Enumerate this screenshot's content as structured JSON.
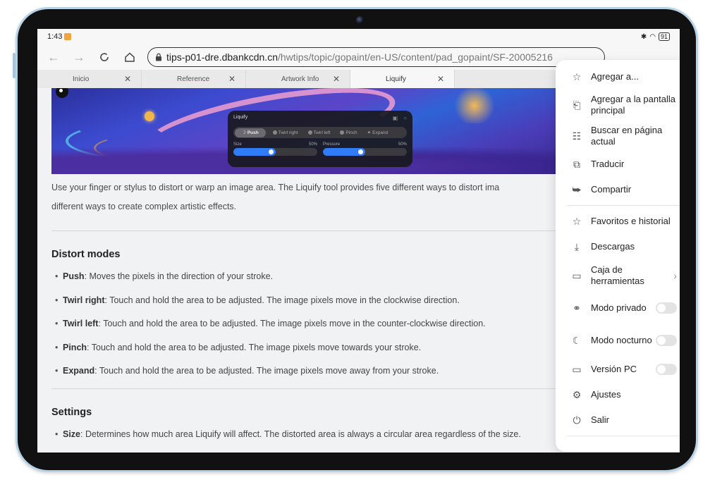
{
  "statusbar": {
    "time": "1:43",
    "battery": "91"
  },
  "toolbar": {
    "url_host": "tips-p01-dre.dbankcdn.cn",
    "url_path": "/hwtips/topic/gopaint/en-US/content/pad_gopaint/SF-20005216"
  },
  "tabs": [
    {
      "label": "Inicio",
      "active": false
    },
    {
      "label": "Reference",
      "active": false
    },
    {
      "label": "Artwork Info",
      "active": false
    },
    {
      "label": "Liquify",
      "active": true
    }
  ],
  "liquify_panel": {
    "title": "Liquify",
    "modes": [
      "Push",
      "Twirl right",
      "Twirl left",
      "Pinch",
      "Expand"
    ],
    "active_mode": "Push",
    "size_label": "Size",
    "size_value": "50%",
    "size_fraction": 0.5,
    "pressure_label": "Pressure",
    "pressure_value": "50%",
    "pressure_fraction": 0.5
  },
  "article": {
    "intro_line1": "Use your finger or stylus to distort or warp an image area. The Liquify tool provides five different ways to distort ima",
    "intro_line2": "different ways to create complex artistic effects.",
    "section1_title": "Distort modes",
    "modes": [
      {
        "term": "Push",
        "desc": ": Moves the pixels in the direction of your stroke."
      },
      {
        "term": "Twirl right",
        "desc": ": Touch and hold the area to be adjusted. The image pixels move in the clockwise direction."
      },
      {
        "term": "Twirl left",
        "desc": ": Touch and hold the area to be adjusted. The image pixels move in the counter-clockwise direction."
      },
      {
        "term": "Pinch",
        "desc": ": Touch and hold the area to be adjusted. The image pixels move towards your stroke."
      },
      {
        "term": "Expand",
        "desc": ": Touch and hold the area to be adjusted. The image pixels move away from your stroke."
      }
    ],
    "section2_title": "Settings",
    "settings": [
      {
        "term": "Size",
        "desc": ": Determines how much area Liquify will affect. The distorted area is always a circular area regardless of the size."
      }
    ]
  },
  "menu": {
    "items": [
      {
        "label": "Agregar a...",
        "icon": "star-icon"
      },
      {
        "label": "Agregar a la pantalla principal",
        "icon": "add-to-home-icon"
      },
      {
        "label": "Buscar en página actual",
        "icon": "find-in-page-icon"
      },
      {
        "label": "Traducir",
        "icon": "translate-icon"
      },
      {
        "label": "Compartir",
        "icon": "share-icon"
      },
      {
        "label": "Favoritos e historial",
        "icon": "bookmarks-history-icon"
      },
      {
        "label": "Descargas",
        "icon": "download-icon"
      },
      {
        "label": "Caja de herramientas",
        "icon": "toolbox-icon"
      },
      {
        "label": "Modo privado",
        "icon": "incognito-icon",
        "toggle": false
      },
      {
        "label": "Modo nocturno",
        "icon": "moon-icon",
        "toggle": false
      },
      {
        "label": "Versión PC",
        "icon": "desktop-icon",
        "toggle": false
      },
      {
        "label": "Ajustes",
        "icon": "settings-icon"
      },
      {
        "label": "Salir",
        "icon": "power-icon"
      }
    ]
  }
}
